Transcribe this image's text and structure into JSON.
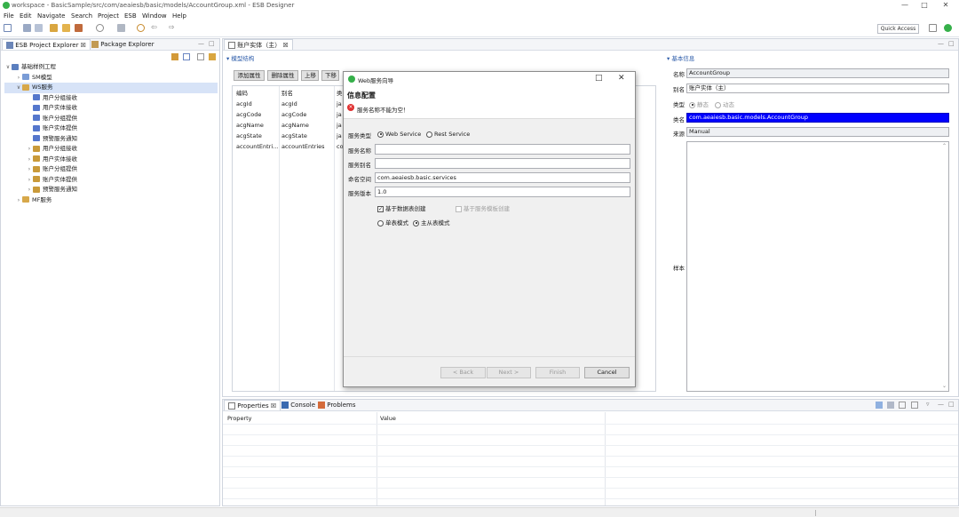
{
  "window": {
    "title": "workspace - BasicSample/src/com/aeaiesb/basic/models/AccountGroup.xml - ESB Designer",
    "min": "—",
    "max": "□",
    "close": "✕"
  },
  "menu": [
    "File",
    "Edit",
    "Navigate",
    "Search",
    "Project",
    "ESB",
    "Window",
    "Help"
  ],
  "toolbar": {
    "quick_access": "Quick Access"
  },
  "explorer": {
    "tabs": [
      "ESB Project Explorer",
      "Package Explorer"
    ],
    "tree": [
      {
        "label": "基础样例工程",
        "level": 0,
        "tw": "∨",
        "color": "#5b7fbf"
      },
      {
        "label": "SM模型",
        "level": 1,
        "tw": "›",
        "color": "#7a9cd6"
      },
      {
        "label": "WS服务",
        "level": 1,
        "tw": "∨",
        "color": "#d7a84a",
        "sel": true
      },
      {
        "label": "用户分组接收",
        "level": 2,
        "tw": "",
        "color": "#5577cc"
      },
      {
        "label": "用户实体接收",
        "level": 2,
        "tw": "",
        "color": "#5577cc"
      },
      {
        "label": "账户分组提供",
        "level": 2,
        "tw": "",
        "color": "#5577cc"
      },
      {
        "label": "账户实体提供",
        "level": 2,
        "tw": "",
        "color": "#5577cc"
      },
      {
        "label": "预警服务通知",
        "level": 2,
        "tw": "",
        "color": "#5577cc"
      },
      {
        "label": "用户分组接收",
        "level": 2,
        "tw": "›",
        "color": "#c99a3a"
      },
      {
        "label": "用户实体接收",
        "level": 2,
        "tw": "›",
        "color": "#c99a3a"
      },
      {
        "label": "账户分组提供",
        "level": 2,
        "tw": "›",
        "color": "#c99a3a"
      },
      {
        "label": "账户实体提供",
        "level": 2,
        "tw": "›",
        "color": "#c99a3a"
      },
      {
        "label": "预警服务通知",
        "level": 2,
        "tw": "›",
        "color": "#c99a3a"
      },
      {
        "label": "MF服务",
        "level": 1,
        "tw": "›",
        "color": "#d7a84a"
      }
    ]
  },
  "editor": {
    "tab": "账户实体（主）",
    "model_section": "模型结构",
    "buttons": [
      "添加属性",
      "删除属性",
      "上移",
      "下移"
    ],
    "columns": [
      "编码",
      "别名",
      "类"
    ],
    "rows": [
      [
        "acgId",
        "acgId",
        "ja"
      ],
      [
        "acgCode",
        "acgCode",
        "ja"
      ],
      [
        "acgName",
        "acgName",
        "ja"
      ],
      [
        "acgState",
        "acgState",
        "ja"
      ],
      [
        "accountEntri...",
        "accountEntries",
        "co"
      ]
    ],
    "basic_section": "基本信息",
    "info": {
      "name_label": "名称",
      "name": "AccountGroup",
      "alias_label": "别名",
      "alias": "账户实体（主）",
      "type_label": "类型",
      "type_options": [
        "静态",
        "动态"
      ],
      "class_label": "类名",
      "class": "com.aeaiesb.basic.models.AccountGroup",
      "source_label": "来源",
      "source": "Manual",
      "sample_label": "样本"
    }
  },
  "dialog": {
    "title": "Web服务向导",
    "section": "信息配置",
    "error": "服务名称不能为空！",
    "service_type_label": "服务类型",
    "service_types": [
      "Web Service",
      "Rest Service"
    ],
    "name_label": "服务名称",
    "alias_label": "服务别名",
    "namespace_label": "命名空间",
    "namespace": "com.aeaiesb.basic.services",
    "version_label": "服务版本",
    "version": "1.0",
    "checks": [
      "基于数据表创建",
      "基于服务模板创建"
    ],
    "modes": [
      "单表模式",
      "主从表模式"
    ],
    "buttons": {
      "back": "< Back",
      "next": "Next >",
      "finish": "Finish",
      "cancel": "Cancel"
    }
  },
  "bottom": {
    "tabs": [
      "Properties",
      "Console",
      "Problems"
    ],
    "columns": [
      "Property",
      "Value"
    ]
  },
  "colors": {
    "accent": "#0a5fd3",
    "selection": "#0000ff",
    "error": "#e03030",
    "logo": "#36b04a"
  }
}
